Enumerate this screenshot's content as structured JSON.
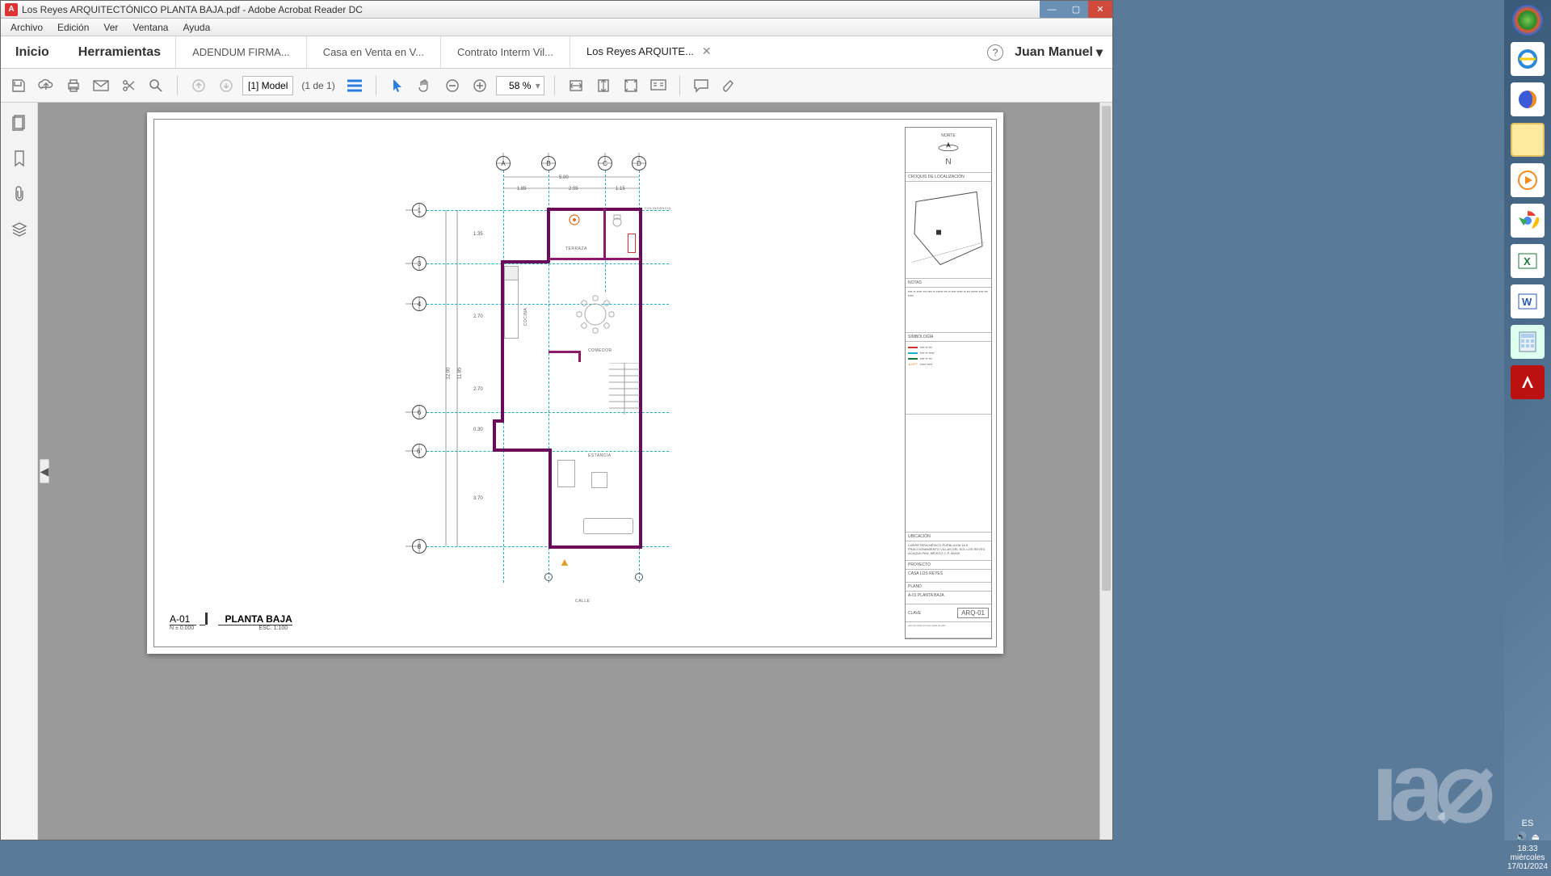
{
  "window": {
    "title": "Los Reyes ARQUITECTÓNICO PLANTA BAJA.pdf - Adobe Acrobat Reader DC",
    "app_icon_letter": "A"
  },
  "menubar": {
    "archivo": "Archivo",
    "edicion": "Edición",
    "ver": "Ver",
    "ventana": "Ventana",
    "ayuda": "Ayuda"
  },
  "header": {
    "home": "Inicio",
    "tools": "Herramientas",
    "tabs": [
      {
        "label": "ADENDUM FIRMA..."
      },
      {
        "label": "Casa en Venta en V..."
      },
      {
        "label": "Contrato Interm Vil..."
      },
      {
        "label": "Los Reyes ARQUITE...",
        "active": true,
        "closeable": true
      }
    ],
    "user": "Juan Manuel"
  },
  "toolbar": {
    "page_box": "[1] Model",
    "page_count": "(1 de 1)",
    "zoom": "58 %"
  },
  "document": {
    "plan_code": "A-01",
    "plan_name": "PLANTA BAJA",
    "plan_level": "N ± 0.000",
    "plan_scale": "ESC. 1:100",
    "calle": "CALLE",
    "titleblock": {
      "norte": "NORTE",
      "n_letter": "N",
      "loc_title": "CROQUIS DE LOCALIZACIÓN",
      "notas_title": "NOTAS",
      "simbol_title": "SIMBOLOGÍA",
      "ubicacion_title": "UBICACIÓN",
      "ubicacion_text": "CARRETERA MÉXICO PUEBLA KM 18.5 FRACCIONAMIENTO VILLAS DEL SOL LOS REYES ACAQUILPAN, MÉXICO C.P. 56400",
      "proyecto_title": "PROYECTO",
      "proyecto_text": "CASA LOS REYES",
      "plano_title": "PLANO",
      "plano_text": "A-01 PLANTA BAJA",
      "clave_title": "CLAVE",
      "clave_value": "ARQ-01"
    },
    "grid": {
      "cols": [
        "A",
        "B",
        "C",
        "D"
      ],
      "rows": [
        "1",
        "3",
        "4",
        "6",
        "6'",
        "8"
      ]
    },
    "dims": {
      "top_total": "5.00",
      "top_a": "1.85",
      "top_b": "2.05",
      "top_c": "1.15",
      "left_total": "12.00",
      "left_inner": "11.85",
      "l1": "1.35",
      "l2": "2.70",
      "l3": "2.70",
      "l4": "0.30",
      "l5": "3.70"
    },
    "rooms": {
      "terraza": "TERRAZA",
      "cocina": "COCINA",
      "comedor": "COMEDOR",
      "estancia": "ESTANCIA",
      "colindancia": "COLINDANCIA"
    }
  },
  "systray": {
    "lang": "ES",
    "time": "18:33",
    "day": "miércoles",
    "date": "17/01/2024"
  }
}
